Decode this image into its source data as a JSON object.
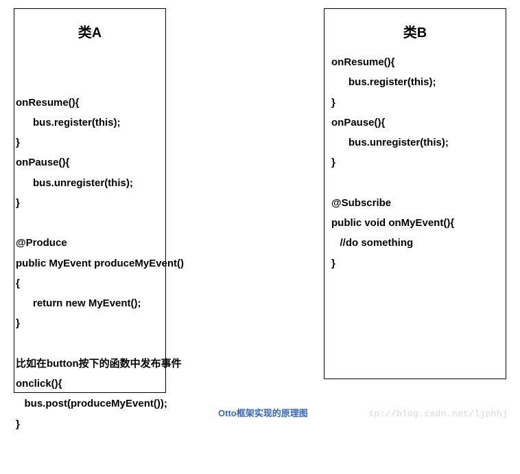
{
  "classA": {
    "title": "类A",
    "code": "onResume(){\n      bus.register(this);\n}\nonPause(){\n      bus.unregister(this);\n}\n\n@Produce\npublic MyEvent produceMyEvent()\n{\n      return new MyEvent();\n}\n\n比如在button按下的函数中发布事件\nonclick(){\n   bus.post(produceMyEvent());\n}"
  },
  "classB": {
    "title": "类B",
    "code": "onResume(){\n      bus.register(this);\n}\nonPause(){\n      bus.unregister(this);\n}\n\n@Subscribe\npublic void onMyEvent(){\n   //do something\n}"
  },
  "caption": "Otto框架实现的原理图",
  "watermark": "tp://blog.csdn.net/ljphhj"
}
